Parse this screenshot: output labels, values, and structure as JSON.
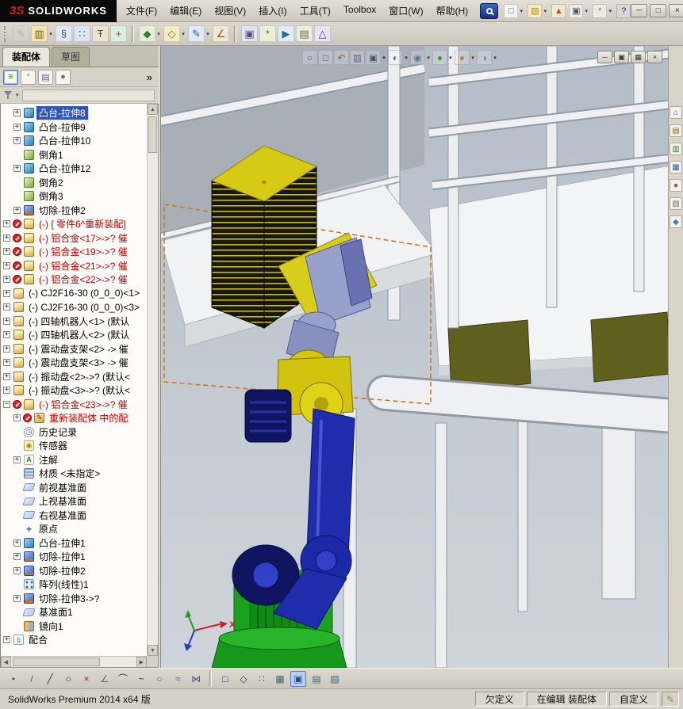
{
  "app": {
    "logo_prefix": "3S",
    "logo_text": "SOLIDWORKS"
  },
  "menubar": {
    "items": [
      {
        "name": "menu-file",
        "label": "文件(F)"
      },
      {
        "name": "menu-edit",
        "label": "编辑(E)"
      },
      {
        "name": "menu-view",
        "label": "视图(V)"
      },
      {
        "name": "menu-insert",
        "label": "插入(I)"
      },
      {
        "name": "menu-tools",
        "label": "工具(T)"
      },
      {
        "name": "menu-toolbox",
        "label": "Toolbox"
      },
      {
        "name": "menu-window",
        "label": "窗口(W)"
      },
      {
        "name": "menu-help",
        "label": "帮助(H)"
      }
    ]
  },
  "titlebar_actions": [
    {
      "name": "new-document-button",
      "glyph": "□",
      "fg": "#3a64a8",
      "bg": "#f4f4f2",
      "caret": true
    },
    {
      "name": "open-document-button",
      "glyph": "▧",
      "fg": "#b08820",
      "bg": "#f6edc8",
      "caret": true
    },
    {
      "name": "publish-edrawings-button",
      "glyph": "▲",
      "fg": "#c05020",
      "bg": "#f0e8d0",
      "caret": false
    },
    {
      "name": "print-button",
      "glyph": "▣",
      "fg": "#555555",
      "bg": "#ecebe6",
      "caret": true
    },
    {
      "name": "options-button",
      "glyph": "*",
      "fg": "#666666",
      "bg": "#ecebe6",
      "caret": true
    },
    {
      "name": "help-button",
      "glyph": "?",
      "fg": "#16337a",
      "bg": "#dcd8d0",
      "caret": false
    }
  ],
  "window_controls": [
    {
      "name": "minimize-button",
      "glyph": "─"
    },
    {
      "name": "maximize-button",
      "glyph": "□"
    },
    {
      "name": "close-button",
      "glyph": "×"
    }
  ],
  "main_toolbar": [
    {
      "name": "edit-component-icon",
      "glyph": "✎",
      "fg": "#8a8a8a",
      "bg": "#d9d6ce",
      "disabled": true
    },
    {
      "name": "insert-components-icon",
      "glyph": "▥",
      "fg": "#7a5c14",
      "bg": "#f2e6b6",
      "caret": true
    },
    {
      "name": "mate-icon",
      "glyph": "§",
      "fg": "#33589c",
      "bg": "#e2e9f4"
    },
    {
      "name": "linear-component-pattern-icon",
      "glyph": "∷",
      "fg": "#2e5ea0",
      "bg": "#dde7f4"
    },
    {
      "name": "smart-fasteners-icon",
      "glyph": "Ŧ",
      "fg": "#6a5a20",
      "bg": "#e9e4d4"
    },
    {
      "name": "move-component-icon",
      "glyph": "+",
      "fg": "#2e7a2e",
      "bg": "#ddeedd"
    },
    {
      "sep": true
    },
    {
      "name": "assembly-features-icon",
      "glyph": "◆",
      "fg": "#3f7a28",
      "bg": "#e3efd8",
      "caret": true
    },
    {
      "name": "reference-geometry-icon",
      "glyph": "◇",
      "fg": "#8a6a14",
      "bg": "#f4ecc6",
      "caret": true
    },
    {
      "name": "sketch-icon",
      "glyph": "✎",
      "fg": "#2858a8",
      "bg": "#e0eaf6",
      "caret": true
    },
    {
      "name": "smart-dimension-icon",
      "glyph": "∠",
      "fg": "#8a5a10",
      "bg": "#efe8d8"
    },
    {
      "sep": true
    },
    {
      "name": "interference-detection-icon",
      "glyph": "▣",
      "fg": "#50508a",
      "bg": "#e4e4ee"
    },
    {
      "name": "exploded-view-icon",
      "glyph": "*",
      "fg": "#4a7a2a",
      "bg": "#e8f0dc"
    },
    {
      "name": "motion-study-icon",
      "glyph": "▶",
      "fg": "#2a6a9a",
      "bg": "#e2ecf2"
    },
    {
      "name": "bill-of-materials-icon",
      "glyph": "▤",
      "fg": "#6a6a4a",
      "bg": "#ececdf"
    },
    {
      "name": "instant3d-icon",
      "glyph": "△",
      "fg": "#5a3a8a",
      "bg": "#eae4f2"
    }
  ],
  "panel": {
    "tabs": [
      {
        "name": "tab-assembly",
        "label": "装配体",
        "active": true
      },
      {
        "name": "tab-sketch",
        "label": "草图",
        "active": false
      }
    ],
    "header_icons": [
      {
        "name": "featuremanager-tree-tab",
        "glyph": "≡",
        "fg": "#2a8a2a",
        "active": true
      },
      {
        "name": "propertymanager-tab",
        "glyph": "*",
        "fg": "#b08a20"
      },
      {
        "name": "configurationmanager-tab",
        "glyph": "▤",
        "fg": "#5a5aa0"
      },
      {
        "name": "appearances-tab",
        "glyph": "●",
        "fg": "#c05050"
      }
    ],
    "overflow": "»",
    "tree": [
      {
        "label": "凸台-拉伸8",
        "icon": "boss-extrude",
        "indent": 1,
        "exp": "+",
        "sel": true
      },
      {
        "label": "凸台-拉伸9",
        "icon": "boss-extrude",
        "indent": 1,
        "exp": "+"
      },
      {
        "label": "凸台-拉伸10",
        "icon": "boss-extrude",
        "indent": 1,
        "exp": "+"
      },
      {
        "label": "倒角1",
        "icon": "chamfer",
        "indent": 1,
        "exp": ""
      },
      {
        "label": "凸台-拉伸12",
        "icon": "boss-extrude",
        "indent": 1,
        "exp": "+"
      },
      {
        "label": "倒角2",
        "icon": "chamfer",
        "indent": 1,
        "exp": ""
      },
      {
        "label": "倒角3",
        "icon": "chamfer",
        "indent": 1,
        "exp": ""
      },
      {
        "label": "切除-拉伸2",
        "icon": "cut-extrude",
        "indent": 1,
        "exp": "+"
      },
      {
        "label": "(-) [ 零件6^重新装配]",
        "icon": "part",
        "indent": 0,
        "exp": "+",
        "color": "red",
        "err": true
      },
      {
        "label": "(-) 铝合金<17>->? 催",
        "icon": "part",
        "indent": 0,
        "exp": "+",
        "color": "red",
        "err": true
      },
      {
        "label": "(-) 铝合金<19>->? 催",
        "icon": "part",
        "indent": 0,
        "exp": "+",
        "color": "red",
        "err": true
      },
      {
        "label": "(-) 铝合金<21>->? 催",
        "icon": "part",
        "indent": 0,
        "exp": "+",
        "color": "red",
        "err": true
      },
      {
        "label": "(-) 铝合金<22>->? 催",
        "icon": "part",
        "indent": 0,
        "exp": "+",
        "color": "red",
        "err": true
      },
      {
        "label": "(-) CJ2F16-30 (0_0_0)<1>",
        "icon": "part",
        "indent": 0,
        "exp": "+"
      },
      {
        "label": "(-) CJ2F16-30 (0_0_0)<3>",
        "icon": "part",
        "indent": 0,
        "exp": "+"
      },
      {
        "label": "(-) 四轴机器人<1> (默认",
        "icon": "part",
        "indent": 0,
        "exp": "+"
      },
      {
        "label": "(-) 四轴机器人<2> (默认",
        "icon": "part",
        "indent": 0,
        "exp": "+"
      },
      {
        "label": "(-) 震动盘支架<2> -> 催",
        "icon": "part",
        "indent": 0,
        "exp": "+"
      },
      {
        "label": "(-) 震动盘支架<3> -> 催",
        "icon": "part",
        "indent": 0,
        "exp": "+"
      },
      {
        "label": "(-) 振动盘<2>->? (默认<",
        "icon": "part",
        "indent": 0,
        "exp": "+"
      },
      {
        "label": "(-) 振动盘<3>->? (默认<",
        "icon": "part",
        "indent": 0,
        "exp": "+"
      },
      {
        "label": "(-) 铝合金<23>->? 催",
        "icon": "part",
        "indent": 0,
        "exp": "−",
        "color": "red",
        "err": true
      },
      {
        "label": "重新装配体 中的配",
        "icon": "subassembly",
        "indent": 1,
        "exp": "+",
        "color": "red",
        "err": true
      },
      {
        "label": "历史记录",
        "icon": "history",
        "indent": 1,
        "exp": ""
      },
      {
        "label": "传感器",
        "icon": "sensors",
        "indent": 1,
        "exp": ""
      },
      {
        "label": "注解",
        "icon": "annotations",
        "indent": 1,
        "exp": "+"
      },
      {
        "label": "材质 <未指定>",
        "icon": "material",
        "indent": 1,
        "exp": ""
      },
      {
        "label": "前视基准面",
        "icon": "plane",
        "indent": 1,
        "exp": ""
      },
      {
        "label": "上视基准面",
        "icon": "plane",
        "indent": 1,
        "exp": ""
      },
      {
        "label": "右视基准面",
        "icon": "plane",
        "indent": 1,
        "exp": ""
      },
      {
        "label": "原点",
        "icon": "origin",
        "indent": 1,
        "exp": ""
      },
      {
        "label": "凸台-拉伸1",
        "icon": "boss-extrude",
        "indent": 1,
        "exp": "+"
      },
      {
        "label": "切除-拉伸1",
        "icon": "cut-extrude",
        "indent": 1,
        "exp": "+"
      },
      {
        "label": "切除-拉伸2",
        "icon": "cut-extrude",
        "indent": 1,
        "exp": "+"
      },
      {
        "label": "阵列(线性)1",
        "icon": "pattern",
        "indent": 1,
        "exp": ""
      },
      {
        "label": "切除-拉伸3->?",
        "icon": "cut-extrude",
        "indent": 1,
        "exp": "+"
      },
      {
        "label": "基准面1",
        "icon": "plane",
        "indent": 1,
        "exp": ""
      },
      {
        "label": "镜向1",
        "icon": "mirror",
        "indent": 1,
        "exp": ""
      },
      {
        "label": "配合",
        "icon": "mates",
        "indent": 0,
        "exp": "+"
      }
    ]
  },
  "viewport": {
    "heads_up": [
      {
        "name": "zoom-to-fit-icon",
        "glyph": "○",
        "fg": "#3a5a8a"
      },
      {
        "name": "zoom-to-area-icon",
        "glyph": "□",
        "fg": "#3a5a8a"
      },
      {
        "name": "previous-view-icon",
        "glyph": "↶",
        "fg": "#7a6a2a"
      },
      {
        "name": "section-view-icon",
        "glyph": "▥",
        "fg": "#4a6a8a"
      },
      {
        "name": "view-orientation-icon",
        "glyph": "▣",
        "fg": "#4a5a7a",
        "caret": true
      },
      {
        "name": "display-style-icon",
        "glyph": "◐",
        "fg": "#5a6a8a",
        "caret": true
      },
      {
        "name": "hide-show-items-icon",
        "glyph": "◉",
        "fg": "#5a7a9a",
        "caret": true
      },
      {
        "name": "edit-appearance-icon",
        "glyph": "●",
        "fg": "#3aa04a",
        "caret": true
      },
      {
        "name": "apply-scene-icon",
        "glyph": "●",
        "fg": "#c28a30",
        "caret": true
      },
      {
        "name": "view-settings-icon",
        "glyph": "◑",
        "fg": "#8a6ac0",
        "caret": true
      }
    ],
    "doc_controls": [
      {
        "name": "doc-minimize-button",
        "glyph": "─"
      },
      {
        "name": "doc-restore-button",
        "glyph": "▣"
      },
      {
        "name": "doc-tile-button",
        "glyph": "▦"
      },
      {
        "name": "doc-close-button",
        "glyph": "×"
      }
    ],
    "task_pane": [
      {
        "name": "resources-home-icon",
        "glyph": "⌂",
        "fg": "#2858a8"
      },
      {
        "name": "design-library-icon",
        "glyph": "▤",
        "fg": "#8a6a20"
      },
      {
        "name": "file-explorer-icon",
        "glyph": "▥",
        "fg": "#3a7a3a"
      },
      {
        "name": "view-palette-icon",
        "glyph": "▦",
        "fg": "#3a5a9a"
      },
      {
        "name": "appearances-icon",
        "glyph": "●",
        "fg": "#c04040"
      },
      {
        "name": "custom-properties-icon",
        "glyph": "▧",
        "fg": "#707070"
      },
      {
        "name": "forum-icon",
        "glyph": "◆",
        "fg": "#4080c0"
      }
    ],
    "triad": {
      "x_label": "X"
    }
  },
  "bottom_toolbar": [
    {
      "name": "sketch-point-icon",
      "glyph": "•",
      "fg": "#555555"
    },
    {
      "name": "centerline-icon",
      "glyph": "/",
      "fg": "#555577"
    },
    {
      "name": "line-icon",
      "glyph": "╱",
      "fg": "#333355"
    },
    {
      "name": "circle-icon",
      "glyph": "○",
      "fg": "#333355"
    },
    {
      "name": "trim-entities-icon",
      "glyph": "×",
      "fg": "#883333"
    },
    {
      "name": "sketch-fillet-icon",
      "glyph": "∠",
      "fg": "#557755"
    },
    {
      "name": "arc-icon",
      "glyph": "⌒",
      "fg": "#333355"
    },
    {
      "name": "spline-icon",
      "glyph": "~",
      "fg": "#333355"
    },
    {
      "name": "ellipse-icon",
      "glyph": "○",
      "fg": "#555599"
    },
    {
      "name": "offset-entities-icon",
      "glyph": "≈",
      "fg": "#555577"
    },
    {
      "name": "mirror-entities-icon",
      "glyph": "⋈",
      "fg": "#555577"
    },
    {
      "sep": true
    },
    {
      "name": "corner-rectangle-icon",
      "glyph": "□",
      "fg": "#333355"
    },
    {
      "name": "polygon-icon",
      "glyph": "◇",
      "fg": "#333355"
    },
    {
      "name": "linear-sketch-pattern-icon",
      "glyph": "∷",
      "fg": "#335577"
    },
    {
      "name": "grid-snap-icon",
      "glyph": "▦",
      "fg": "#446666"
    },
    {
      "name": "sheet-format-icon",
      "glyph": "▣",
      "fg": "#2a4a9a",
      "active": true
    },
    {
      "name": "tables-icon",
      "glyph": "▤",
      "fg": "#446666"
    },
    {
      "name": "area-hatch-icon",
      "glyph": "▨",
      "fg": "#446666"
    }
  ],
  "statusbar": {
    "left_text": "SolidWorks Premium 2014 x64 版",
    "cells": [
      {
        "name": "status-definition",
        "label": "欠定义"
      },
      {
        "name": "status-editing",
        "label": "在编辑 装配体"
      },
      {
        "name": "status-custom",
        "label": "自定义"
      }
    ],
    "pencil_glyph": "✎"
  },
  "ui": {
    "scroll_up": "▲",
    "scroll_down": "▼",
    "scroll_left": "◀",
    "scroll_right": "▶"
  },
  "scene_colors": {
    "wall_gray": "#a9afb7",
    "structure_white": "#eef0f3",
    "structure_edge": "#949aa2",
    "panel_olive": "#60601e",
    "stack_yellow": "#d6ca14",
    "robot_blue": "#1f2dac",
    "robot_blue_dark": "#0f1560",
    "robot_green": "#19a21e",
    "robot_yellow": "#d7c90a",
    "gripper_lavender": "#98a0cc",
    "gripper_violet": "#6a71b2",
    "selection_orange": "#c87a1e",
    "triad_x": "#cc2020",
    "triad_y": "#20a020",
    "triad_z": "#2040cc"
  }
}
